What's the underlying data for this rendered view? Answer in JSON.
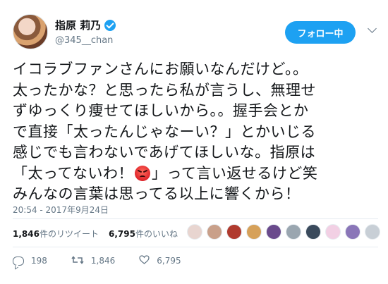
{
  "user": {
    "display_name": "指原 莉乃",
    "handle": "@345__chan",
    "verified": true
  },
  "follow_button": {
    "label": "フォロー中"
  },
  "tweet": {
    "lines": [
      "イコラブファンさんにお願いなんだけど。。",
      "太ったかな？と思ったら私が言うし、無理せ",
      "ずゆっくり痩せてほしいから。。握手会とか",
      "で直接「太ったんじゃなーい？」とかいじる",
      "感じでも言わないであげてほしいな。指原は",
      "「太ってないわ！",
      "」って言い返せるけど笑",
      "みんなの言葉は思ってる以上に響くから！"
    ],
    "emoji": "angry-face-icon"
  },
  "timestamp": "20:54 - 2017年9月24日",
  "stats": {
    "retweets_count": "1,846",
    "retweets_label": "件のリツイート",
    "likes_count": "6,795",
    "likes_label": "件のいいね"
  },
  "likers": [
    {
      "color": "#e8d5d0"
    },
    {
      "color": "#c9a08a"
    },
    {
      "color": "#b03a2e"
    },
    {
      "color": "#d6a15a"
    },
    {
      "color": "#6a4a8c"
    },
    {
      "color": "#9aa6b0"
    },
    {
      "color": "#3a4a5c"
    },
    {
      "color": "#f2d0e4"
    },
    {
      "color": "#8a76b8"
    },
    {
      "color": "#c8cfd6"
    }
  ],
  "actions": {
    "reply_count": "198",
    "retweet_count": "1,846",
    "like_count": "6,795"
  },
  "colors": {
    "accent": "#1da1f2",
    "muted": "#657786",
    "text": "#14171a"
  }
}
